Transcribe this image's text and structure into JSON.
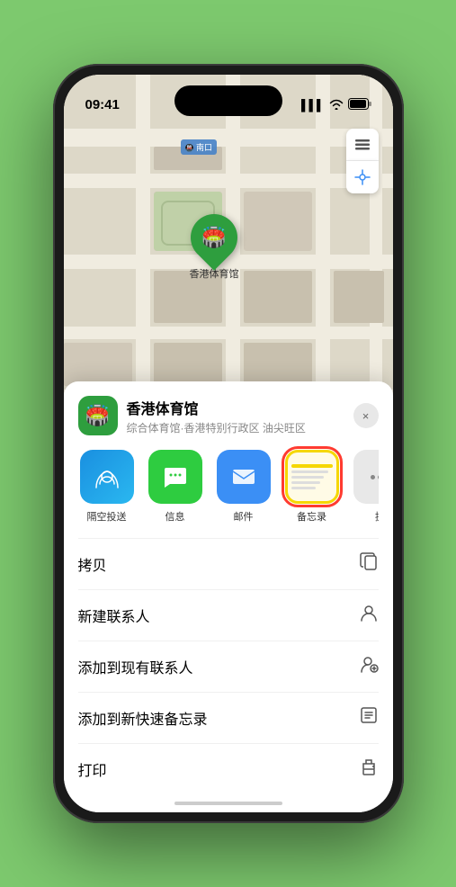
{
  "status_bar": {
    "time": "09:41",
    "signal": "▌▌▌",
    "wifi": "WiFi",
    "battery": "🔋"
  },
  "map": {
    "label": "南口",
    "map_layer_label": "地图",
    "location_label": "定位"
  },
  "venue": {
    "name": "香港体育馆",
    "subtitle": "综合体育馆·香港特别行政区 油尖旺区",
    "icon": "🏟️"
  },
  "share_items": [
    {
      "id": "airdrop",
      "label": "隔空投送",
      "type": "airdrop"
    },
    {
      "id": "message",
      "label": "信息",
      "type": "message"
    },
    {
      "id": "mail",
      "label": "邮件",
      "type": "mail"
    },
    {
      "id": "notes",
      "label": "备忘录",
      "type": "notes",
      "selected": true
    },
    {
      "id": "more",
      "label": "提",
      "type": "more"
    }
  ],
  "actions": [
    {
      "id": "copy",
      "label": "拷贝",
      "icon": "copy"
    },
    {
      "id": "new-contact",
      "label": "新建联系人",
      "icon": "person"
    },
    {
      "id": "add-contact",
      "label": "添加到现有联系人",
      "icon": "person-add"
    },
    {
      "id": "quick-note",
      "label": "添加到新快速备忘录",
      "icon": "note"
    },
    {
      "id": "print",
      "label": "打印",
      "icon": "printer"
    }
  ],
  "pin_label": "香港体育馆",
  "close_btn": "×",
  "home_indicator": ""
}
